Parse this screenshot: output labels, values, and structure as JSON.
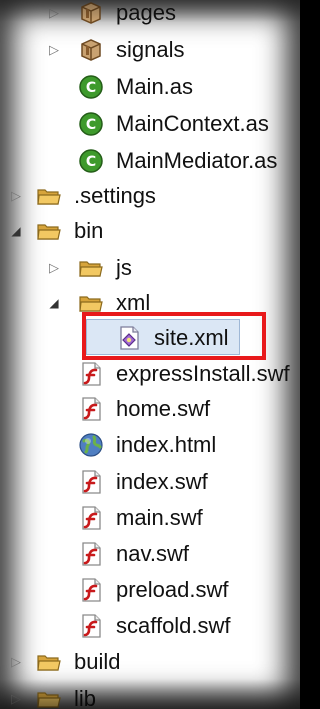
{
  "tree": {
    "rows": [
      {
        "label": "pages",
        "icon": "package-icon",
        "expanded": false
      },
      {
        "label": "signals",
        "icon": "package-icon",
        "expanded": false
      },
      {
        "label": "Main.as",
        "icon": "as-class-icon"
      },
      {
        "label": "MainContext.as",
        "icon": "as-class-icon"
      },
      {
        "label": "MainMediator.as",
        "icon": "as-class-icon"
      },
      {
        "label": ".settings",
        "icon": "folder-icon",
        "expanded": false
      },
      {
        "label": "bin",
        "icon": "folder-icon",
        "expanded": true
      },
      {
        "label": "js",
        "icon": "folder-icon",
        "expanded": false
      },
      {
        "label": "xml",
        "icon": "folder-icon",
        "expanded": true
      },
      {
        "label": "site.xml",
        "icon": "xml-file-icon",
        "selected": true
      },
      {
        "label": "expressInstall.swf",
        "icon": "flash-file-icon"
      },
      {
        "label": "home.swf",
        "icon": "flash-file-icon"
      },
      {
        "label": "index.html",
        "icon": "html-globe-icon"
      },
      {
        "label": "index.swf",
        "icon": "flash-file-icon"
      },
      {
        "label": "main.swf",
        "icon": "flash-file-icon"
      },
      {
        "label": "nav.swf",
        "icon": "flash-file-icon"
      },
      {
        "label": "preload.swf",
        "icon": "flash-file-icon"
      },
      {
        "label": "scaffold.swf",
        "icon": "flash-file-icon"
      },
      {
        "label": "build",
        "icon": "folder-icon",
        "expanded": false
      },
      {
        "label": "lib",
        "icon": "folder-icon",
        "expanded": false
      }
    ]
  },
  "colors": {
    "highlight": "#e8191b",
    "selection": "#dbe7f5",
    "folder": "#e9b949",
    "as_class": "#3e9a2c",
    "flash": "#c8191b"
  }
}
